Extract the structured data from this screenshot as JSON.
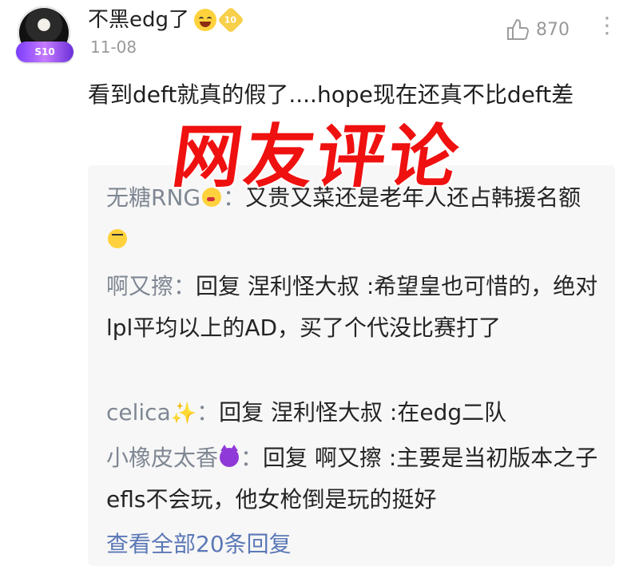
{
  "header": {
    "username": "不黑edg了",
    "level": "10",
    "avatar_badge": "S10",
    "date": "11-08",
    "likes": "870"
  },
  "comment": {
    "text": "看到deft就真的假了....hope现在还真不比deft差"
  },
  "overlay": {
    "title": "网友评论"
  },
  "replies": [
    {
      "name": "无糖RNG",
      "sep": "：",
      "text": "又贵又菜还是老年人还占韩援名额"
    },
    {
      "name": "啊又擦",
      "sep": "：",
      "text": "回复 涅利怪大叔 :希望皇也可惜的，绝对lpl平均以上的AD，买了个代没比赛打了"
    },
    {
      "name": "celica",
      "sep": "：",
      "text": "回复 涅利怪大叔 :在edg二队"
    },
    {
      "name": "小橡皮太香",
      "sep": "：",
      "text": "回复 啊又擦 :主要是当初版本之子efls不会玩，他女枪倒是玩的挺好"
    }
  ],
  "footer": {
    "view_all": "查看全部20条回复"
  },
  "icons": {
    "like": "thumbs-up-icon",
    "more": "more-vertical-icon"
  }
}
